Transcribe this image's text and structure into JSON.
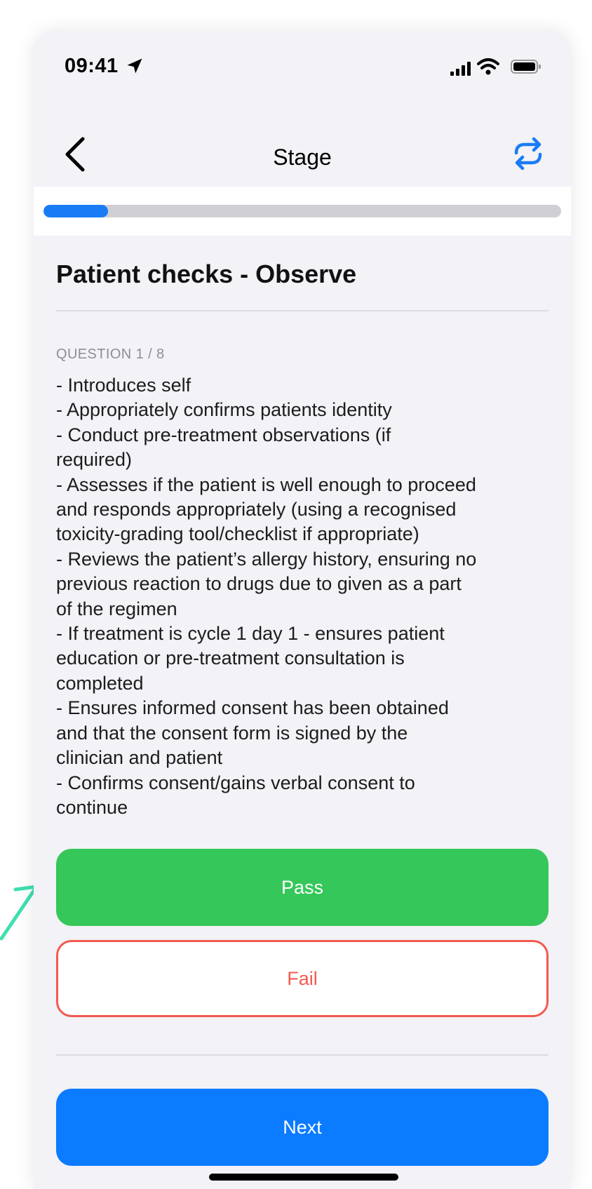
{
  "status_bar": {
    "time": "09:41",
    "icons": [
      "location-arrow-icon",
      "signal-bars-icon",
      "wifi-icon",
      "battery-icon"
    ]
  },
  "nav": {
    "title": "Stage",
    "back_icon": "chevron-left-icon",
    "action_icon": "refresh-repeat-icon"
  },
  "progress": {
    "value": 0.125,
    "fill_color": "#1a7cf5",
    "track_color": "#cfcfd4"
  },
  "section": {
    "title": "Patient checks - Observe"
  },
  "question": {
    "counter": "QUESTION 1 / 8",
    "lines": [
      "- Introduces self",
      "- Appropriately confirms patients identity",
      "- Conduct pre-treatment observations (if",
      "required)",
      "- Assesses if the patient is well enough to proceed",
      "and responds appropriately (using a recognised",
      "toxicity-grading tool/checklist if appropriate)",
      "- Reviews the patient’s allergy history, ensuring no",
      "previous reaction to drugs due to given as a part",
      "of the regimen",
      "- If treatment is cycle 1 day 1 - ensures patient",
      "education or pre-treatment consultation is",
      "completed",
      "- Ensures informed consent has been obtained",
      "and that the consent form is signed by the",
      "clinician and patient",
      "- Confirms consent/gains verbal consent to",
      "continue"
    ]
  },
  "actions": {
    "pass_label": "Pass",
    "fail_label": "Fail",
    "next_label": "Next"
  },
  "colors": {
    "pass": "#35c759",
    "fail": "#f25a50",
    "next": "#0b7bff",
    "accent": "#1a7cf5",
    "annotation_arrow": "#3ee0b0"
  }
}
